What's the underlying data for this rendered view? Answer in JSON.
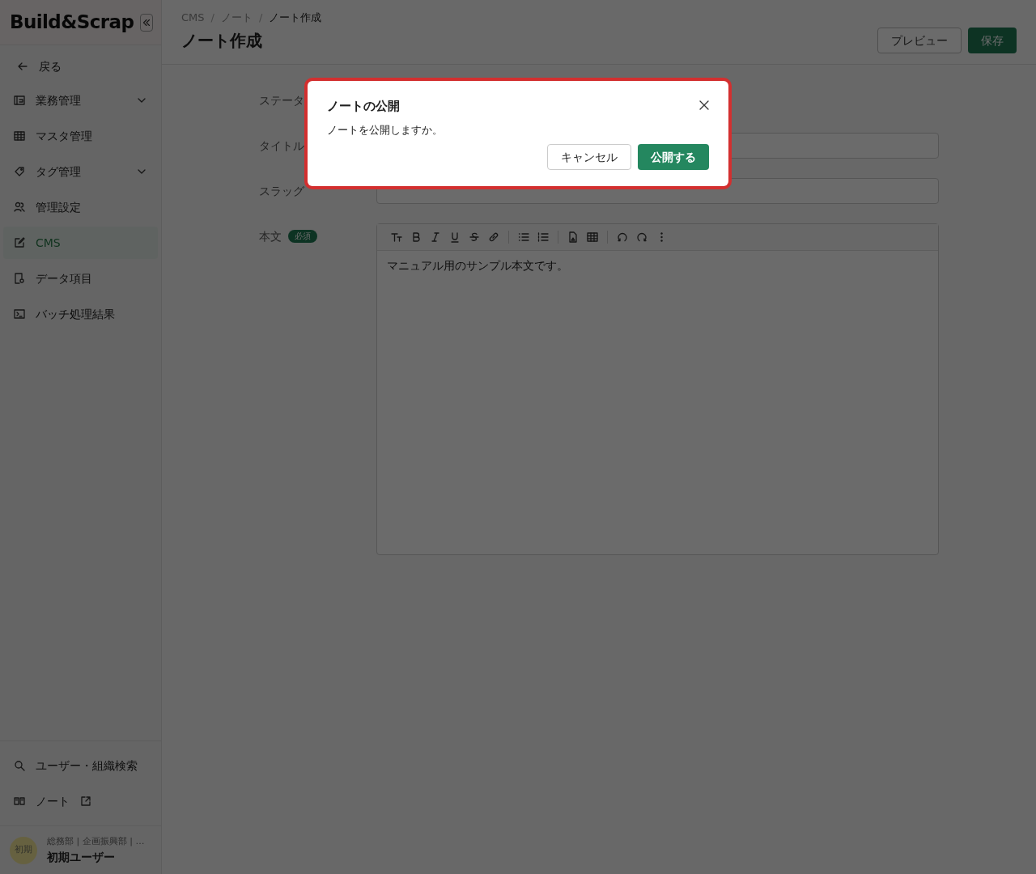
{
  "sidebar": {
    "logo": "**Build**&**Scrap**",
    "back": "戻る",
    "items": [
      {
        "label": "業務管理",
        "expandable": true,
        "selected": false
      },
      {
        "label": "マスタ管理",
        "expandable": false,
        "selected": false
      },
      {
        "label": "タグ管理",
        "expandable": true,
        "selected": false
      },
      {
        "label": "管理設定",
        "expandable": false,
        "selected": false
      },
      {
        "label": "CMS",
        "expandable": false,
        "selected": true
      },
      {
        "label": "データ項目",
        "expandable": false,
        "selected": false
      },
      {
        "label": "バッチ処理結果",
        "expandable": false,
        "selected": false
      }
    ],
    "footer_items": [
      {
        "label": "ユーザー・組織検索",
        "external": false
      },
      {
        "label": "ノート",
        "external": true
      }
    ],
    "user": {
      "avatar": "初期",
      "org": "総務部 | 企画振興部 | …",
      "name": "初期ユーザー"
    }
  },
  "header": {
    "breadcrumbs": [
      "CMS",
      "ノート",
      "ノート作成"
    ],
    "separator": "/",
    "title": "ノート作成",
    "buttons": [
      "プレビュー",
      "保存"
    ]
  },
  "form": {
    "fields": [
      {
        "label": "ステータ",
        "kind": "none"
      },
      {
        "label": "タイトル",
        "kind": "input"
      },
      {
        "label": "スラッグ",
        "kind": "input"
      },
      {
        "label": "本文",
        "kind": "editor",
        "required": true,
        "badge": "必須",
        "value": "マニュアル用のサンプル本文です。"
      }
    ]
  },
  "dialog": {
    "title": "ノートの公開",
    "message": "ノートを公開しますか。",
    "buttons": [
      "キャンセル",
      "公開する"
    ]
  }
}
